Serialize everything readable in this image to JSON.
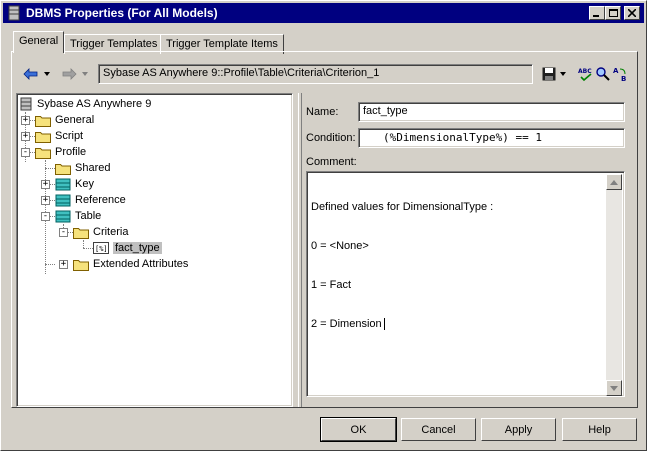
{
  "window": {
    "title": "DBMS Properties (For All Models)",
    "icon": "dbms-icon",
    "controls": [
      "minimize-icon",
      "maximize-icon",
      "close-icon"
    ]
  },
  "tabs": [
    {
      "label": "General",
      "active": true
    },
    {
      "label": "Trigger Templates",
      "active": false
    },
    {
      "label": "Trigger Template Items",
      "active": false
    }
  ],
  "toolbar": {
    "path": "Sybase AS Anywhere 9::Profile\\Table\\Criteria\\Criterion_1",
    "icons": [
      "back-arrow-icon",
      "forward-arrow-icon",
      "save-icon",
      "spell-check-icon",
      "find-icon",
      "replace-icon"
    ]
  },
  "tree": {
    "root": "Sybase AS Anywhere 9",
    "items": [
      {
        "label": "General",
        "expander": "+"
      },
      {
        "label": "Script",
        "expander": "+"
      },
      {
        "label": "Profile",
        "expander": "-"
      },
      {
        "label": "Shared",
        "expander": ""
      },
      {
        "label": "Key",
        "expander": "+"
      },
      {
        "label": "Reference",
        "expander": "+"
      },
      {
        "label": "Table",
        "expander": "-"
      },
      {
        "label": "Criteria",
        "expander": "-"
      },
      {
        "label": "fact_type",
        "expander": "",
        "selected": true
      },
      {
        "label": "Extended Attributes",
        "expander": "+"
      }
    ]
  },
  "form": {
    "name_label": "Name:",
    "name_value": "fact_type",
    "condition_label": "Condition:",
    "condition_value": "(%DimensionalType%) == 1",
    "comment_label": "Comment:",
    "comment_lines": [
      "Defined values for DimensionalType :",
      "0 = <None>",
      "1 = Fact",
      "2 = Dimension"
    ]
  },
  "buttons": {
    "ok": "OK",
    "cancel": "Cancel",
    "apply": "Apply",
    "help": "Help"
  },
  "colors": {
    "titlebar": "#000080",
    "folder": "#f6e27c",
    "selected": "#c0c0c0"
  }
}
